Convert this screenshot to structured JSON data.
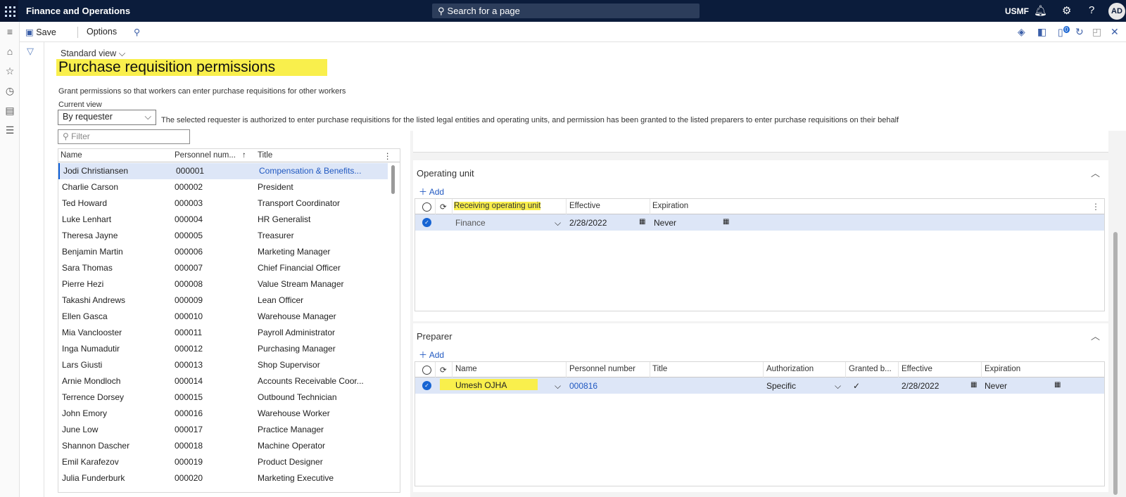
{
  "app": {
    "title": "Finance and Operations",
    "search_placeholder": "Search for a page",
    "company": "USMF",
    "user_initials": "AD",
    "icons": [
      "waffle-icon",
      "bell-icon",
      "gear-icon",
      "help-icon"
    ]
  },
  "actionbar": {
    "save_label": "Save",
    "options_label": "Options",
    "badge_count": "0"
  },
  "header": {
    "view_name": "Standard view",
    "page_title": "Purchase requisition permissions",
    "description": "Grant permissions so that workers can enter purchase requisitions for other workers",
    "current_view_label": "Current view",
    "current_view_value": "By requester",
    "info_text": "The selected requester is authorized to enter purchase requisitions for the listed legal entities and operating units, and permission has been granted to the listed preparers to enter purchase requisitions on their behalf",
    "filter_placeholder": "Filter"
  },
  "requesters": {
    "columns": [
      "Name",
      "Personnel num...",
      "Title"
    ],
    "rows": [
      {
        "name": "Jodi Christiansen",
        "number": "000001",
        "title": "Compensation & Benefits..."
      },
      {
        "name": "Charlie Carson",
        "number": "000002",
        "title": "President"
      },
      {
        "name": "Ted Howard",
        "number": "000003",
        "title": "Transport Coordinator"
      },
      {
        "name": "Luke Lenhart",
        "number": "000004",
        "title": "HR Generalist"
      },
      {
        "name": "Theresa Jayne",
        "number": "000005",
        "title": "Treasurer"
      },
      {
        "name": "Benjamin Martin",
        "number": "000006",
        "title": "Marketing Manager"
      },
      {
        "name": "Sara Thomas",
        "number": "000007",
        "title": "Chief Financial Officer"
      },
      {
        "name": "Pierre Hezi",
        "number": "000008",
        "title": "Value Stream Manager"
      },
      {
        "name": "Takashi Andrews",
        "number": "000009",
        "title": "Lean Officer"
      },
      {
        "name": "Ellen Gasca",
        "number": "000010",
        "title": "Warehouse Manager"
      },
      {
        "name": "Mia Vanclooster",
        "number": "000011",
        "title": "Payroll Administrator"
      },
      {
        "name": "Inga Numadutir",
        "number": "000012",
        "title": "Purchasing Manager"
      },
      {
        "name": "Lars Giusti",
        "number": "000013",
        "title": "Shop Supervisor"
      },
      {
        "name": "Arnie Mondloch",
        "number": "000014",
        "title": "Accounts Receivable Coor..."
      },
      {
        "name": "Terrence Dorsey",
        "number": "000015",
        "title": "Outbound Technician"
      },
      {
        "name": "John Emory",
        "number": "000016",
        "title": "Warehouse Worker"
      },
      {
        "name": "June Low",
        "number": "000017",
        "title": "Practice Manager"
      },
      {
        "name": "Shannon Dascher",
        "number": "000018",
        "title": "Machine Operator"
      },
      {
        "name": "Emil Karafezov",
        "number": "000019",
        "title": "Product Designer"
      },
      {
        "name": "Julia Funderburk",
        "number": "000020",
        "title": "Marketing Executive"
      }
    ]
  },
  "operating_unit": {
    "title": "Operating unit",
    "add_label": "Add",
    "columns": [
      "Receiving operating unit",
      "Effective",
      "Expiration"
    ],
    "row": {
      "unit": "Finance",
      "effective": "2/28/2022",
      "expiration": "Never"
    }
  },
  "preparer": {
    "title": "Preparer",
    "add_label": "Add",
    "columns": [
      "Name",
      "Personnel number",
      "Title",
      "Authorization",
      "Granted b...",
      "Effective",
      "Expiration"
    ],
    "row": {
      "name": "Umesh OJHA",
      "number": "000816",
      "title": "",
      "authorization": "Specific",
      "granted": "✓",
      "effective": "2/28/2022",
      "expiration": "Never"
    }
  },
  "colors": {
    "topbar": "#0b1c3b",
    "highlight": "#f9ef4c",
    "selected_row": "#dde6f7",
    "link": "#2159c1"
  }
}
